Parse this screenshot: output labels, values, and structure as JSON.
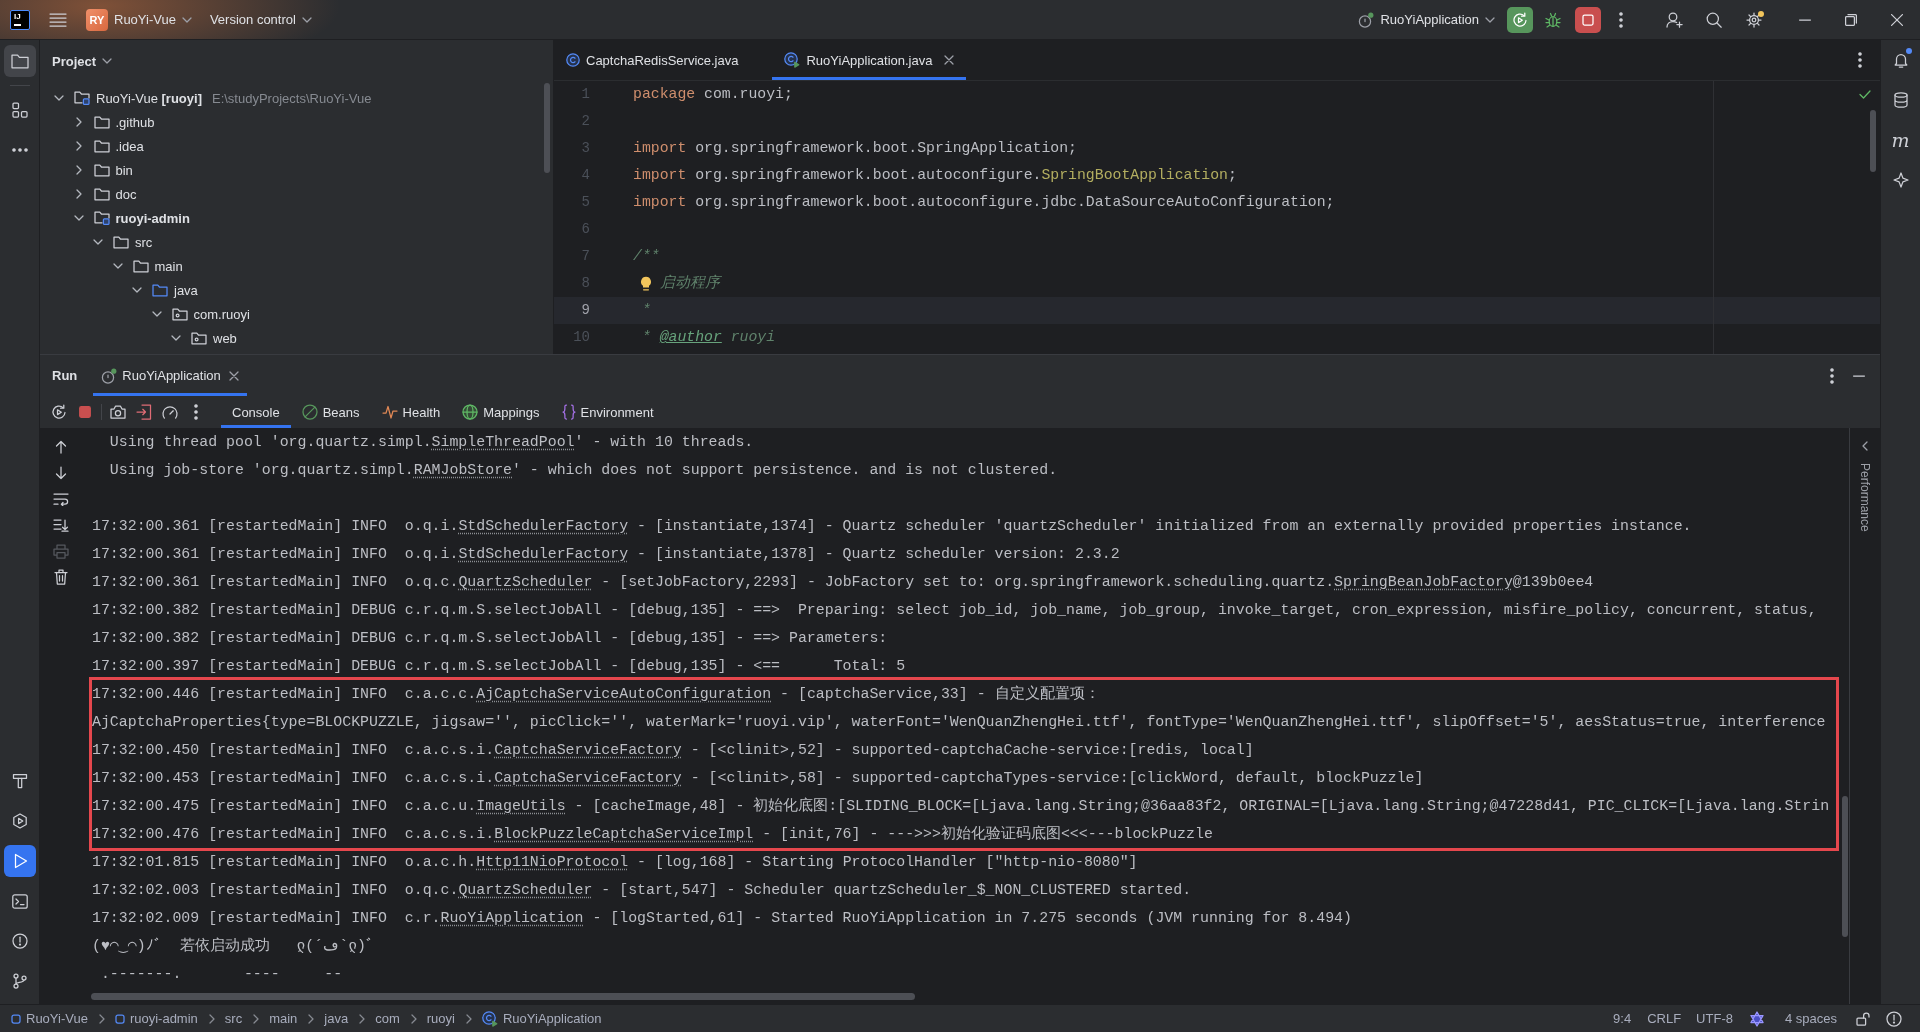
{
  "title_bar": {
    "logo": "IJ",
    "project_badge": "RY",
    "project": "RuoYi-Vue",
    "vcs": "Version control",
    "run_config": "RuoYiApplication",
    "settings_update": true
  },
  "left_toolbar": {
    "top": [
      {
        "kind": "project",
        "selected": true,
        "focused": false
      },
      {
        "kind": "structure",
        "selected": false,
        "focused": false
      },
      {
        "kind": "more",
        "selected": false,
        "focused": false
      }
    ],
    "bottom": [
      {
        "kind": "build",
        "selected": false,
        "focused": false
      },
      {
        "kind": "services",
        "selected": false,
        "focused": false
      },
      {
        "kind": "run",
        "selected": true,
        "focused": true
      },
      {
        "kind": "terminal",
        "selected": false,
        "focused": false
      },
      {
        "kind": "problems",
        "selected": false,
        "focused": false
      },
      {
        "kind": "git",
        "selected": false,
        "focused": false
      }
    ]
  },
  "project_panel": {
    "title": "Project",
    "tree": [
      {
        "label": "RuoYi-Vue **[ruoyi]**",
        "path": "E:\\studyProjects\\RuoYi-Vue",
        "kind": "module",
        "bold": false,
        "expanded": true,
        "children": [
          {
            "label": ".github",
            "kind": "folder",
            "bold": false,
            "expanded": false
          },
          {
            "label": ".idea",
            "kind": "folder",
            "bold": false,
            "expanded": false
          },
          {
            "label": "bin",
            "kind": "folder",
            "bold": false,
            "expanded": false
          },
          {
            "label": "doc",
            "kind": "folder",
            "bold": false,
            "expanded": false
          },
          {
            "label": "ruoyi-admin",
            "kind": "module",
            "bold": true,
            "expanded": true,
            "children": [
              {
                "label": "src",
                "kind": "folder",
                "bold": false,
                "expanded": true,
                "children": [
                  {
                    "label": "main",
                    "kind": "folder",
                    "bold": false,
                    "expanded": true,
                    "children": [
                      {
                        "label": "java",
                        "kind": "source",
                        "bold": false,
                        "expanded": true,
                        "children": [
                          {
                            "label": "com.ruoyi",
                            "kind": "package",
                            "bold": false,
                            "expanded": true,
                            "children": [
                              {
                                "label": "web",
                                "kind": "package",
                                "bold": false,
                                "expanded": true
                              }
                            ]
                          }
                        ]
                      }
                    ]
                  }
                ]
              }
            ]
          }
        ]
      }
    ]
  },
  "editor": {
    "tabs": [
      {
        "label": "CaptchaRedisService.java",
        "kind": "class",
        "selected": false
      },
      {
        "label": "RuoYiApplication.java",
        "kind": "app_class",
        "selected": true
      }
    ],
    "no_problems": true,
    "lines": [
      {
        "number": "1",
        "current": false,
        "hint": false,
        "tokens": [
          {
            "kind": "keyword",
            "text": "package"
          },
          {
            "kind": "plain",
            "text": " com.ruoyi;"
          }
        ]
      },
      {
        "number": "2",
        "current": false,
        "hint": false
      },
      {
        "number": "3",
        "current": false,
        "hint": false,
        "tokens": [
          {
            "kind": "keyword",
            "text": "import"
          },
          {
            "kind": "plain",
            "text": " org.springframework.boot.SpringApplication;"
          }
        ]
      },
      {
        "number": "4",
        "current": false,
        "hint": false,
        "tokens": [
          {
            "kind": "keyword",
            "text": "import"
          },
          {
            "kind": "plain",
            "text": " org.springframework.boot.autoconfigure."
          },
          {
            "kind": "annotation",
            "text": "SpringBootApplication"
          },
          {
            "kind": "plain",
            "text": ";"
          }
        ]
      },
      {
        "number": "5",
        "current": false,
        "hint": false,
        "tokens": [
          {
            "kind": "keyword",
            "text": "import"
          },
          {
            "kind": "plain",
            "text": " org.springframework.boot.autoconfigure.jdbc.DataSourceAutoConfiguration;"
          }
        ]
      },
      {
        "number": "6",
        "current": false,
        "hint": false
      },
      {
        "number": "7",
        "current": false,
        "hint": false,
        "tokens": [
          {
            "kind": "comment",
            "text": "/**"
          }
        ]
      },
      {
        "number": "8",
        "current": false,
        "hint": true,
        "tokens": [
          {
            "kind": "comment",
            "text": "启动程序"
          }
        ]
      },
      {
        "number": "9",
        "current": true,
        "hint": false,
        "tokens": [
          {
            "kind": "comment",
            "text": " *"
          }
        ]
      },
      {
        "number": "10",
        "current": false,
        "hint": false,
        "tokens": [
          {
            "kind": "comment",
            "text": " * "
          },
          {
            "kind": "doc_tag",
            "text": "@author"
          },
          {
            "kind": "comment",
            "text": " ruoyi"
          }
        ]
      }
    ]
  },
  "right_toolbar": {
    "notifications_unread": true,
    "maven_label": "m"
  },
  "run_panel": {
    "title": "Run",
    "tabs": [
      {
        "label": "RuoYiApplication",
        "selected": true
      }
    ],
    "views": [
      {
        "kind": "console",
        "label": "Console",
        "selected": true
      },
      {
        "kind": "beans",
        "label": "Beans",
        "selected": false
      },
      {
        "kind": "health",
        "label": "Health",
        "selected": false
      },
      {
        "kind": "mappings",
        "label": "Mappings",
        "selected": false
      },
      {
        "kind": "environment",
        "label": "Environment",
        "selected": false
      }
    ],
    "console_actions": [
      {
        "kind": "up",
        "disabled": false
      },
      {
        "kind": "down",
        "disabled": false
      },
      {
        "kind": "wrap",
        "disabled": false
      },
      {
        "kind": "scroll_end",
        "disabled": false
      },
      {
        "kind": "print",
        "disabled": true
      },
      {
        "kind": "clear",
        "disabled": false
      }
    ],
    "side_panel": "Performance",
    "console": [
      {
        "highlighted": false,
        "lines": [
          {
            "kind": "log",
            "parts": [
              {
                "kind": "text",
                "text": "  Using thread pool 'org.quartz.simpl."
              },
              {
                "kind": "link",
                "text": "SimpleThreadPool"
              },
              {
                "kind": "text",
                "text": "' - with 10 threads."
              }
            ]
          },
          {
            "kind": "log",
            "parts": [
              {
                "kind": "text",
                "text": "  Using job-store 'org.quartz.simpl."
              },
              {
                "kind": "link",
                "text": "RAMJobStore"
              },
              {
                "kind": "text",
                "text": "' - which does not support persistence. and is not clustered."
              }
            ]
          },
          {
            "kind": "blank"
          },
          {
            "kind": "log",
            "parts": [
              {
                "kind": "text",
                "text": "17:32:00.361 [restartedMain] INFO  o.q.i."
              },
              {
                "kind": "link",
                "text": "StdSchedulerFactory"
              },
              {
                "kind": "text",
                "text": " - [instantiate,1374] - Quartz scheduler 'quartzScheduler' initialized from an externally provided properties instance."
              }
            ]
          },
          {
            "kind": "log",
            "parts": [
              {
                "kind": "text",
                "text": "17:32:00.361 [restartedMain] INFO  o.q.i."
              },
              {
                "kind": "link",
                "text": "StdSchedulerFactory"
              },
              {
                "kind": "text",
                "text": " - [instantiate,1378] - Quartz scheduler version: 2.3.2"
              }
            ]
          },
          {
            "kind": "log",
            "parts": [
              {
                "kind": "text",
                "text": "17:32:00.361 [restartedMain] INFO  o.q.c."
              },
              {
                "kind": "link",
                "text": "QuartzScheduler"
              },
              {
                "kind": "text",
                "text": " - [setJobFactory,2293] - JobFactory set to: org.springframework.scheduling.quartz."
              },
              {
                "kind": "link",
                "text": "SpringBeanJobFactory"
              },
              {
                "kind": "text",
                "text": "@139b0ee4"
              }
            ]
          },
          {
            "kind": "log",
            "parts": [
              {
                "kind": "text",
                "text": "17:32:00.382 [restartedMain] DEBUG c.r.q.m.S.selectJobAll - [debug,135] - ==>  Preparing: select job_id, job_name, job_group, invoke_target, cron_expression, misfire_policy, concurrent, status,"
              }
            ]
          },
          {
            "kind": "log",
            "parts": [
              {
                "kind": "text",
                "text": "17:32:00.382 [restartedMain] DEBUG c.r.q.m.S.selectJobAll - [debug,135] - ==> Parameters:"
              }
            ]
          },
          {
            "kind": "log",
            "parts": [
              {
                "kind": "text",
                "text": "17:32:00.397 [restartedMain] DEBUG c.r.q.m.S.selectJobAll - [debug,135] - <==      Total: 5"
              }
            ]
          }
        ]
      },
      {
        "highlighted": true,
        "lines": [
          {
            "kind": "log",
            "parts": [
              {
                "kind": "text",
                "text": "17:32:00.446 [restartedMain] INFO  c.a.c.c."
              },
              {
                "kind": "link",
                "text": "AjCaptchaServiceAutoConfiguration"
              },
              {
                "kind": "text",
                "text": " - [captchaService,33] - 自定义配置项："
              }
            ]
          },
          {
            "kind": "log",
            "parts": [
              {
                "kind": "text",
                "text": "AjCaptchaProperties{type=BLOCKPUZZLE, jigsaw='', picClick='', waterMark='ruoyi.vip', waterFont='WenQuanZhengHei.ttf', fontType='WenQuanZhengHei.ttf', slipOffset='5', aesStatus=true, interference"
              }
            ]
          },
          {
            "kind": "log",
            "parts": [
              {
                "kind": "text",
                "text": "17:32:00.450 [restartedMain] INFO  c.a.c.s.i."
              },
              {
                "kind": "link",
                "text": "CaptchaServiceFactory"
              },
              {
                "kind": "text",
                "text": " - [<clinit>,52] - supported-captchaCache-service:[redis, local]"
              }
            ]
          },
          {
            "kind": "log",
            "parts": [
              {
                "kind": "text",
                "text": "17:32:00.453 [restartedMain] INFO  c.a.c.s.i."
              },
              {
                "kind": "link",
                "text": "CaptchaServiceFactory"
              },
              {
                "kind": "text",
                "text": " - [<clinit>,58] - supported-captchaTypes-service:[clickWord, default, blockPuzzle]"
              }
            ]
          },
          {
            "kind": "log",
            "parts": [
              {
                "kind": "text",
                "text": "17:32:00.475 [restartedMain] INFO  c.a.c.u."
              },
              {
                "kind": "link",
                "text": "ImageUtils"
              },
              {
                "kind": "text",
                "text": " - [cacheImage,48] - 初始化底图:[SLIDING_BLOCK=[Ljava.lang.String;@36aa83f2, ORIGINAL=[Ljava.lang.String;@47228d41, PIC_CLICK=[Ljava.lang.Strin"
              }
            ]
          },
          {
            "kind": "log",
            "parts": [
              {
                "kind": "text",
                "text": "17:32:00.476 [restartedMain] INFO  c.a.c.s.i."
              },
              {
                "kind": "link",
                "text": "BlockPuzzleCaptchaServiceImpl"
              },
              {
                "kind": "text",
                "text": " - [init,76] - --->>>初始化验证码底图<<<---blockPuzzle"
              }
            ]
          }
        ]
      },
      {
        "highlighted": false,
        "lines": [
          {
            "kind": "log",
            "parts": [
              {
                "kind": "text",
                "text": "17:32:01.815 [restartedMain] INFO  o.a.c.h."
              },
              {
                "kind": "link",
                "text": "Http11NioProtocol"
              },
              {
                "kind": "text",
                "text": " - [log,168] - Starting ProtocolHandler [\"http-nio-8080\"]"
              }
            ]
          },
          {
            "kind": "log",
            "parts": [
              {
                "kind": "text",
                "text": "17:32:02.003 [restartedMain] INFO  o.q.c."
              },
              {
                "kind": "link",
                "text": "QuartzScheduler"
              },
              {
                "kind": "text",
                "text": " - [start,547] - Scheduler quartzScheduler_$_NON_CLUSTERED started."
              }
            ]
          },
          {
            "kind": "log",
            "parts": [
              {
                "kind": "text",
                "text": "17:32:02.009 [restartedMain] INFO  c.r."
              },
              {
                "kind": "link",
                "text": "RuoYiApplication"
              },
              {
                "kind": "text",
                "text": " - [logStarted,61] - Started RuoYiApplication in 7.275 seconds (JVM running for 8.494)"
              }
            ]
          },
          {
            "kind": "log",
            "parts": [
              {
                "kind": "text",
                "text": "(♥◠‿◠)ﾉﾞ  若依启动成功   ლ(´ڡ`ლ)ﾞ"
              }
            ]
          },
          {
            "kind": "log",
            "parts": [
              {
                "kind": "text",
                "text": " .-------.       ----     --"
              }
            ]
          }
        ]
      }
    ]
  },
  "status_bar": {
    "breadcrumbs": [
      {
        "kind": "module",
        "label": "RuoYi-Vue"
      },
      {
        "kind": "module",
        "label": "ruoyi-admin"
      },
      {
        "kind": "folder",
        "label": "src"
      },
      {
        "kind": "folder",
        "label": "main"
      },
      {
        "kind": "folder",
        "label": "java"
      },
      {
        "kind": "folder",
        "label": "com"
      },
      {
        "kind": "folder",
        "label": "ruoyi"
      },
      {
        "kind": "class",
        "label": "RuoYiApplication"
      }
    ],
    "caret": "9:4",
    "line_separator": "CRLF",
    "encoding": "UTF-8",
    "indent": "4 spaces"
  }
}
